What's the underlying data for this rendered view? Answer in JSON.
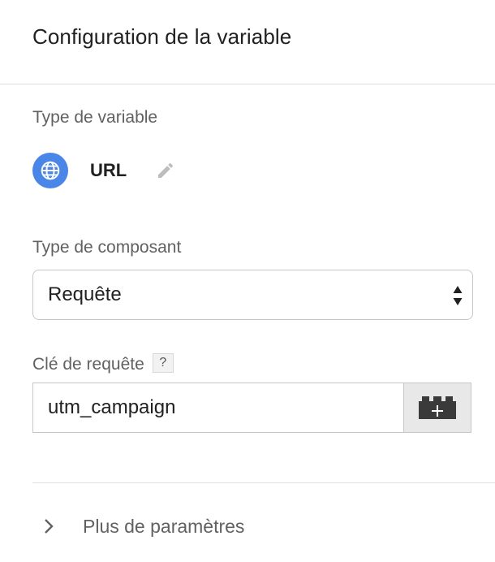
{
  "header": {
    "title": "Configuration de la variable"
  },
  "variable_type": {
    "label": "Type de variable",
    "name": "URL",
    "icon": "globe-icon",
    "icon_bg_color": "#4a86e8",
    "edit_icon": "pencil-icon"
  },
  "component_type": {
    "label": "Type de composant",
    "selected": "Requête"
  },
  "query_key": {
    "label": "Clé de requête",
    "help": "?",
    "value": "utm_campaign",
    "variable_button_icon": "lego-block-plus-icon"
  },
  "more_settings": {
    "label": "Plus de paramètres",
    "icon": "chevron-right-icon"
  }
}
